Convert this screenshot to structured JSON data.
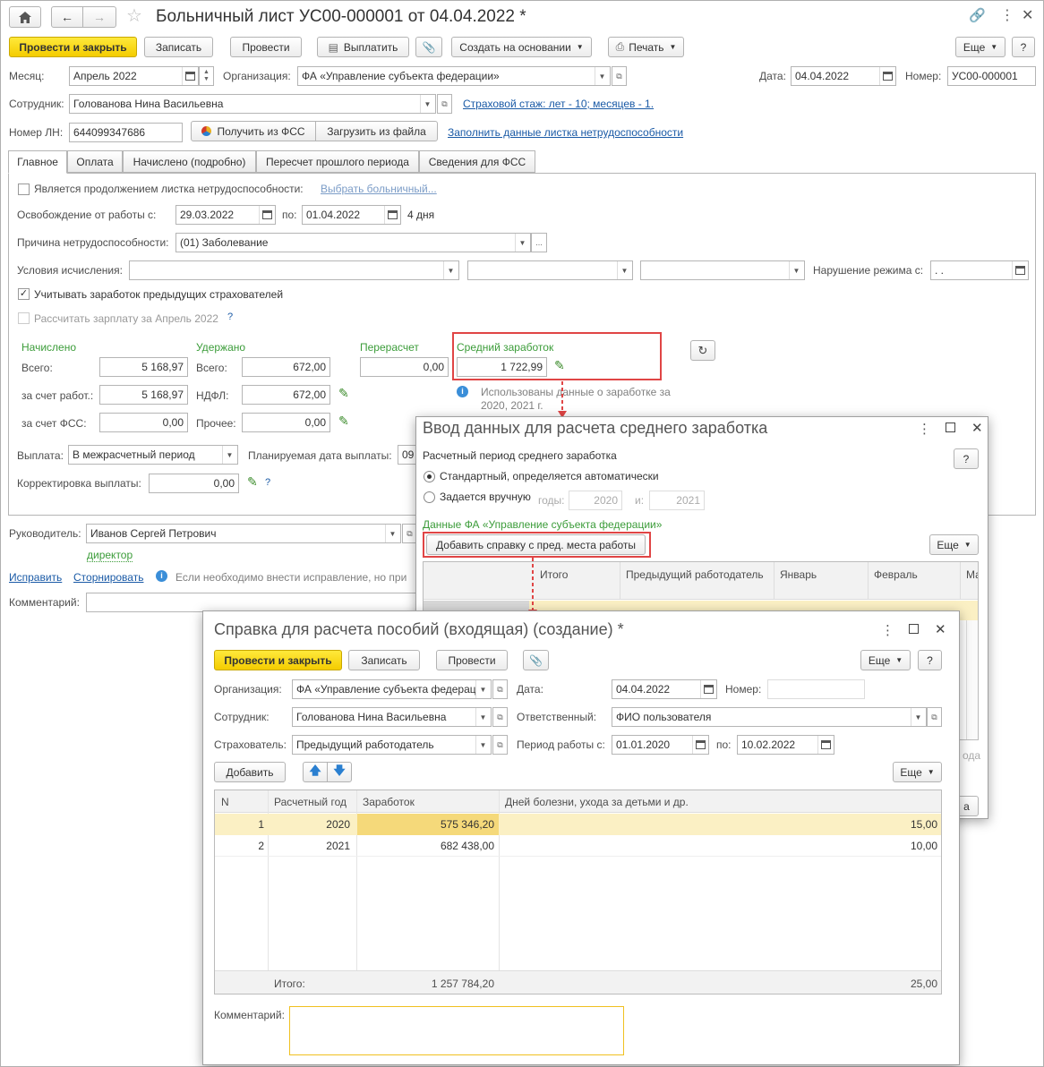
{
  "main": {
    "title": "Больничный лист УС00-000001 от 04.04.2022 *",
    "toolbar": {
      "post_close": "Провести и закрыть",
      "save": "Записать",
      "post": "Провести",
      "pay": "Выплатить",
      "create_based": "Создать на основании",
      "print": "Печать",
      "more": "Еще",
      "help": "?"
    },
    "month_label": "Месяц:",
    "month_value": "Апрель 2022",
    "org_label": "Организация:",
    "org_value": "ФА «Управление субъекта федерации»",
    "date_label": "Дата:",
    "date_value": "04.04.2022",
    "number_label": "Номер:",
    "number_value": "УС00-000001",
    "employee_label": "Сотрудник:",
    "employee_value": "Голованова Нина Васильевна",
    "insurance_link": "Страховой стаж: лет - 10; месяцев - 1.",
    "ln_label": "Номер ЛН:",
    "ln_value": "644099347686",
    "get_fss": "Получить из ФСС",
    "load_file": "Загрузить из файла",
    "fill_link": "Заполнить данные листка нетрудоспособности",
    "tabs": [
      "Главное",
      "Оплата",
      "Начислено (подробно)",
      "Пересчет прошлого периода",
      "Сведения для ФСС"
    ],
    "continuation_label": "Является продолжением листка нетрудоспособности:",
    "choose_sick_link": "Выбрать больничный...",
    "release_label": "Освобождение от работы с:",
    "release_from": "29.03.2022",
    "release_to_label": "по:",
    "release_to": "01.04.2022",
    "days": "4 дня",
    "reason_label": "Причина нетрудоспособности:",
    "reason_value": "(01) Заболевание",
    "conditions_label": "Условия исчисления:",
    "violation_label": "Нарушение режима с:",
    "violation_value": " .  .",
    "consider_label": "Учитывать заработок предыдущих страхователей",
    "calc_salary_label": "Рассчитать зарплату за Апрель 2022",
    "q": "?",
    "accrued": {
      "header": "Начислено",
      "total_label": "Всего:",
      "total": "5 168,97",
      "employer_label": "за счет работ.:",
      "employer": "5 168,97",
      "fss_label": "за счет ФСС:",
      "fss": "0,00"
    },
    "withheld": {
      "header": "Удержано",
      "total_label": "Всего:",
      "total": "672,00",
      "ndfl_label": "НДФЛ:",
      "ndfl": "672,00",
      "other_label": "Прочее:",
      "other": "0,00"
    },
    "recalc": {
      "header": "Перерасчет",
      "value": "0,00"
    },
    "avg": {
      "header": "Средний заработок",
      "value": "1 722,99",
      "info_line1": "Использованы данные о заработке за",
      "info_line2": "2020,  2021 г."
    },
    "payout_label": "Выплата:",
    "payout_value": "В межрасчетный период",
    "planned_label": "Планируемая дата выплаты:",
    "planned_value": "09",
    "correction_label": "Корректировка выплаты:",
    "correction_value": "0,00",
    "manager_label": "Руководитель:",
    "manager_value": "Иванов Сергей Петрович",
    "manager_role": "директор",
    "fix_link": "Исправить",
    "storno_link": "Сторнировать",
    "fix_info": "Если необходимо внести исправление, но при",
    "comment_label": "Комментарий:"
  },
  "avg_dialog": {
    "title": "Ввод данных для расчета среднего заработка",
    "period_label": "Расчетный период среднего заработка",
    "radio_auto": "Стандартный, определяется автоматически",
    "radio_manual": "Задается вручную",
    "years_label": "годы:",
    "year1": "2020",
    "and_label": "и:",
    "year2": "2021",
    "org_data": "Данные ФА «Управление субъекта федерации»",
    "add_cert": "Добавить справку с пред. места работы",
    "more": "Еще",
    "help": "?",
    "columns": [
      "Итого",
      "Предыдущий работодатель",
      "Январь",
      "Февраль",
      "Ма"
    ],
    "partial_text": "ода",
    "partial_btn": "а"
  },
  "cert_dialog": {
    "title": "Справка для расчета пособий (входящая) (создание) *",
    "post_close": "Провести и закрыть",
    "save": "Записать",
    "post": "Провести",
    "more": "Еще",
    "help": "?",
    "org_label": "Организация:",
    "org_value": "ФА «Управление субъекта федерац",
    "date_label": "Дата:",
    "date_value": "04.04.2022",
    "number_label": "Номер:",
    "employee_label": "Сотрудник:",
    "employee_value": "Голованова Нина Васильевна",
    "responsible_label": "Ответственный:",
    "responsible_value": "ФИО пользователя",
    "insurer_label": "Страхователь:",
    "insurer_value": "Предыдущий работодатель",
    "period_label": "Период работы с:",
    "period_from": "01.01.2020",
    "period_to_label": "по:",
    "period_to": "10.02.2022",
    "add": "Добавить",
    "columns": [
      "N",
      "Расчетный год",
      "Заработок",
      "Дней болезни, ухода за детьми и др."
    ],
    "rows": [
      {
        "n": "1",
        "year": "2020",
        "earnings": "575 346,20",
        "days": "15,00"
      },
      {
        "n": "2",
        "year": "2021",
        "earnings": "682 438,00",
        "days": "10,00"
      }
    ],
    "total_label": "Итого:",
    "total_earnings": "1 257 784,20",
    "total_days": "25,00",
    "comment_label": "Комментарий:"
  }
}
